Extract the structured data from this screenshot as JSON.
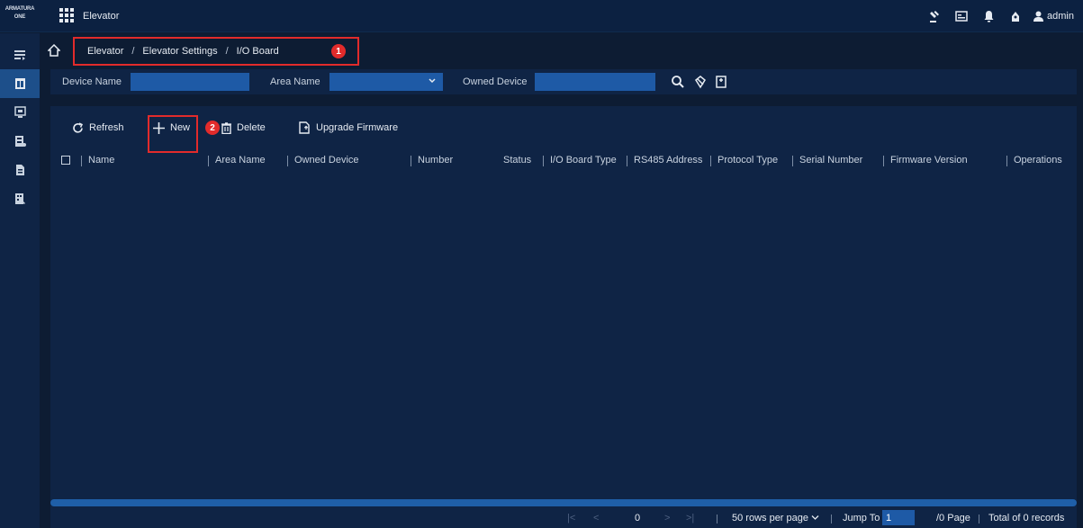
{
  "app": {
    "logo_line1": "ARMATURA",
    "logo_line2": "ONE",
    "title": "Elevator",
    "user": "admin"
  },
  "breadcrumb": {
    "items": [
      "Elevator",
      "Elevator Settings",
      "I/O Board"
    ],
    "separator": "/",
    "badge": "1"
  },
  "filters": {
    "device_name_label": "Device Name",
    "device_name_value": "",
    "area_name_label": "Area Name",
    "area_name_value": "",
    "owned_device_label": "Owned Device",
    "owned_device_value": ""
  },
  "toolbar": {
    "refresh": "Refresh",
    "new": "New",
    "new_badge": "2",
    "delete": "Delete",
    "upgrade": "Upgrade Firmware"
  },
  "table": {
    "columns": [
      "Name",
      "Area Name",
      "Owned Device",
      "Number",
      "Status",
      "I/O Board Type",
      "RS485 Address",
      "Protocol Type",
      "Serial Number",
      "Firmware Version",
      "Operations"
    ],
    "rows": []
  },
  "pagination": {
    "current": "0",
    "rows_per_page": "50 rows per page",
    "jump_to_label": "Jump To",
    "jump_value": "1",
    "page_total": "/0 Page",
    "total_records": "Total of 0 records"
  },
  "colors": {
    "accent": "#1e5aa6",
    "highlight": "#e22b2b",
    "panel": "#0f2445",
    "background": "#0d1c33"
  }
}
